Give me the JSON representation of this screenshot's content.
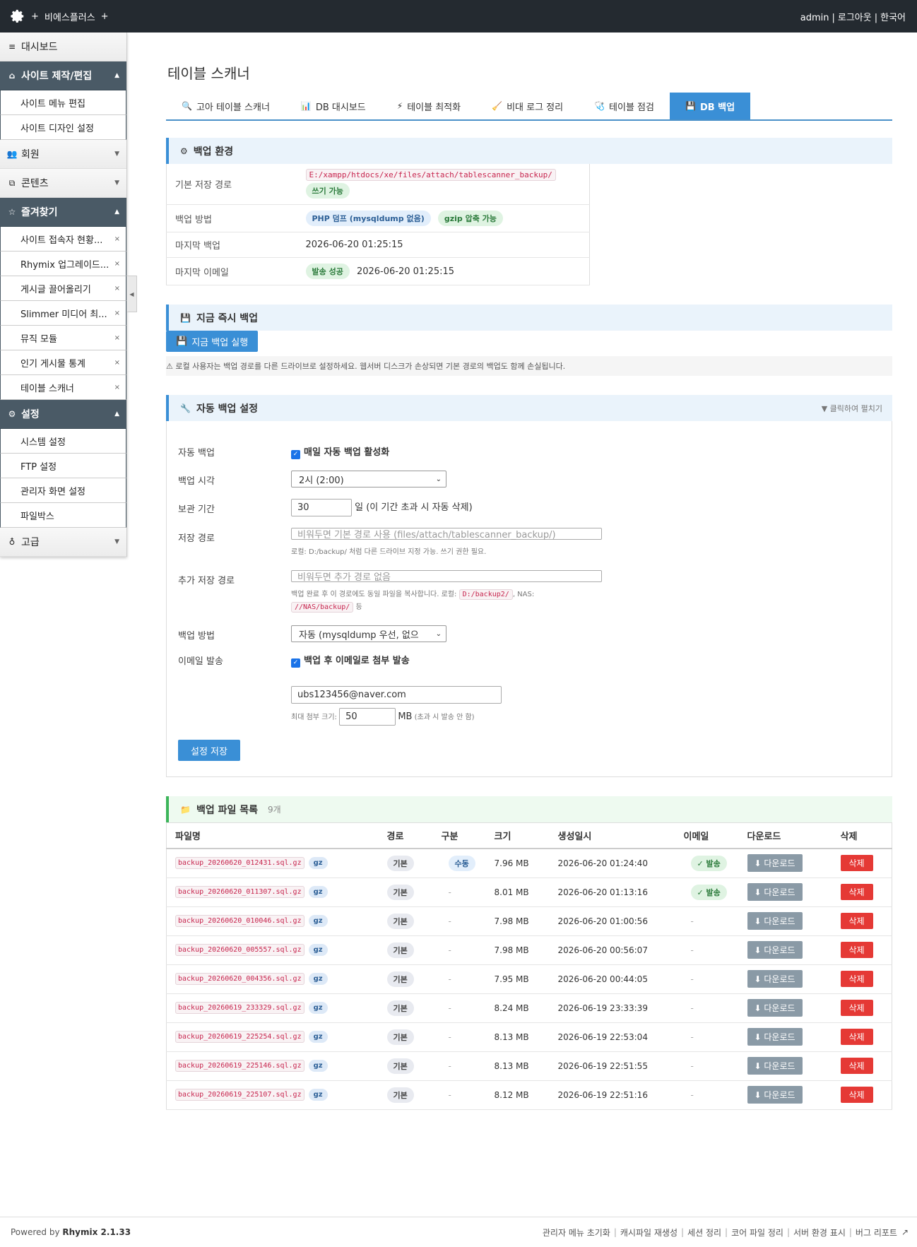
{
  "topbar": {
    "site_name": "비에스플러스",
    "plus": "+",
    "user": "admin",
    "logout": "로그아웃",
    "lang": "한국어"
  },
  "sidebar": {
    "dashboard": "대시보드",
    "groups": [
      {
        "label": "사이트 제작/편집",
        "icon": "home-icon",
        "open": true,
        "items": [
          "사이트 메뉴 편집",
          "사이트 디자인 설정"
        ]
      },
      {
        "label": "회원",
        "icon": "users-icon",
        "open": false,
        "items": []
      },
      {
        "label": "콘텐츠",
        "icon": "copy-icon",
        "open": false,
        "items": []
      },
      {
        "label": "즐겨찾기",
        "icon": "star-icon",
        "open": true,
        "items": [
          "사이트 접속자 현황...",
          "Rhymix 업그레이드...",
          "게시글 끌어올리기",
          "Slimmer 미디어 최...",
          "뮤직 모듈",
          "인기 게시물 통계",
          "테이블 스캐너"
        ]
      },
      {
        "label": "설정",
        "icon": "gear-icon",
        "open": true,
        "items": [
          "시스템 설정",
          "FTP 설정",
          "관리자 화면 설정",
          "파일박스"
        ]
      },
      {
        "label": "고급",
        "icon": "bulb-icon",
        "open": false,
        "items": []
      }
    ],
    "remove_mark": "×"
  },
  "page": {
    "title": "테이블 스캐너",
    "tabs": [
      {
        "label": "고아 테이블 스캐너",
        "icon": "🔍",
        "active": false
      },
      {
        "label": "DB 대시보드",
        "icon": "📊",
        "active": false
      },
      {
        "label": "테이블 최적화",
        "icon": "⚡",
        "active": false
      },
      {
        "label": "비대 로그 정리",
        "icon": "🧹",
        "active": false
      },
      {
        "label": "테이블 점검",
        "icon": "🩺",
        "active": false
      },
      {
        "label": "DB 백업",
        "icon": "💾",
        "active": true
      }
    ]
  },
  "env": {
    "title": "백업 환경",
    "rows": {
      "path_label": "기본 저장 경로",
      "path_value": "E:/xampp/htdocs/xe/files/attach/tablescanner_backup/",
      "path_badge": "쓰기 가능",
      "method_label": "백업 방법",
      "method_badge1": "PHP 덤프 (mysqldump 없음)",
      "method_badge2": "gzip 압축 가능",
      "last_backup_label": "마지막 백업",
      "last_backup_value": "2026-06-20 01:25:15",
      "last_email_label": "마지막 이메일",
      "last_email_badge": "발송 성공",
      "last_email_value": "2026-06-20 01:25:15"
    }
  },
  "now_backup": {
    "title": "지금 즉시 백업",
    "button": "지금 백업 실행",
    "warning": "⚠ 로컬 사용자는 백업 경로를 다른 드라이브로 설정하세요. 웹서버 디스크가 손상되면 기본 경로의 백업도 함께 손실됩니다."
  },
  "auto": {
    "title": "자동 백업 설정",
    "expand": "▼ 클릭하여 펼치기",
    "auto_label": "자동 백업",
    "auto_check": "매일 자동 백업 활성화",
    "time_label": "백업 시각",
    "time_value": "2시 (2:00)",
    "keep_label": "보관 기간",
    "keep_value": "30",
    "keep_suffix": "일 (이 기간 초과 시 자동 삭제)",
    "path_label": "저장 경로",
    "path_placeholder": "비워두면 기본 경로 사용 (files/attach/tablescanner_backup/)",
    "path_hint": "로컬: D:/backup/ 처럼 다른 드라이브 지정 가능. 쓰기 권한 필요.",
    "extra_label": "추가 저장 경로",
    "extra_placeholder": "비워두면 추가 경로 없음",
    "extra_hint_a": "백업 완료 후 이 경로에도 동일 파일을 복사합니다. 로컬:",
    "extra_hint_code1": "D:/backup2/",
    "extra_hint_b": ", NAS:",
    "extra_hint_code2": "//NAS/backup/",
    "extra_hint_c": "등",
    "method_label": "백업 방법",
    "method_value": "자동 (mysqldump 우선, 없으",
    "email_label": "이메일 발송",
    "email_check": "백업 후 이메일로 첨부 발송",
    "email_value": "ubs123456@naver.com",
    "maxsize_label": "최대 첨부 크기:",
    "maxsize_value": "50",
    "maxsize_unit": "MB",
    "maxsize_note": "(초과 시 발송 안 함)",
    "save": "설정 저장"
  },
  "files": {
    "title": "백업 파일 목록",
    "count": "9개",
    "headers": [
      "파일명",
      "경로",
      "구분",
      "크기",
      "생성일시",
      "이메일",
      "다운로드",
      "삭제"
    ],
    "download_label": "⬇ 다운로드",
    "delete_label": "삭제",
    "gz": "gz",
    "rows": [
      {
        "name": "backup_20260620_012431.sql.gz",
        "path": "기본",
        "kind": "수동",
        "size": "7.96 MB",
        "date": "2026-06-20 01:24:40",
        "email": "✓ 발송"
      },
      {
        "name": "backup_20260620_011307.sql.gz",
        "path": "기본",
        "kind": "-",
        "size": "8.01 MB",
        "date": "2026-06-20 01:13:16",
        "email": "✓ 발송"
      },
      {
        "name": "backup_20260620_010046.sql.gz",
        "path": "기본",
        "kind": "-",
        "size": "7.98 MB",
        "date": "2026-06-20 01:00:56",
        "email": "-"
      },
      {
        "name": "backup_20260620_005557.sql.gz",
        "path": "기본",
        "kind": "-",
        "size": "7.98 MB",
        "date": "2026-06-20 00:56:07",
        "email": "-"
      },
      {
        "name": "backup_20260620_004356.sql.gz",
        "path": "기본",
        "kind": "-",
        "size": "7.95 MB",
        "date": "2026-06-20 00:44:05",
        "email": "-"
      },
      {
        "name": "backup_20260619_233329.sql.gz",
        "path": "기본",
        "kind": "-",
        "size": "8.24 MB",
        "date": "2026-06-19 23:33:39",
        "email": "-"
      },
      {
        "name": "backup_20260619_225254.sql.gz",
        "path": "기본",
        "kind": "-",
        "size": "8.13 MB",
        "date": "2026-06-19 22:53:04",
        "email": "-"
      },
      {
        "name": "backup_20260619_225146.sql.gz",
        "path": "기본",
        "kind": "-",
        "size": "8.13 MB",
        "date": "2026-06-19 22:51:55",
        "email": "-"
      },
      {
        "name": "backup_20260619_225107.sql.gz",
        "path": "기본",
        "kind": "-",
        "size": "8.12 MB",
        "date": "2026-06-19 22:51:16",
        "email": "-"
      }
    ]
  },
  "footer": {
    "powered": "Powered by",
    "product": "Rhymix 2.1.33",
    "links": [
      "관리자 메뉴 초기화",
      "캐시파일 재생성",
      "세션 정리",
      "코어 파일 정리",
      "서버 환경 표시",
      "버그 리포트"
    ]
  },
  "colors": {
    "topbar": "#242a30",
    "accent": "#3a8fd6",
    "danger": "#e53935",
    "sidebar_open": "#4a5a66"
  }
}
